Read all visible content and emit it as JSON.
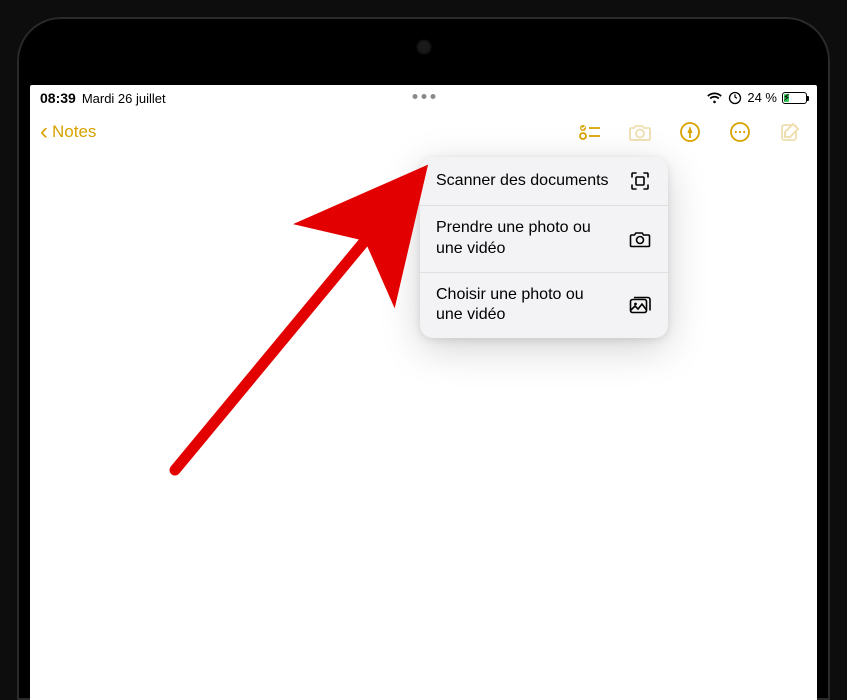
{
  "status": {
    "time": "08:39",
    "date": "Mardi 26 juillet",
    "battery_percent": "24 %",
    "battery_fill_pct": 24
  },
  "toolbar": {
    "back_label": "Notes"
  },
  "popover": {
    "items": [
      {
        "label": "Scanner des documents",
        "icon": "scan-icon"
      },
      {
        "label": "Prendre une photo ou une vidéo",
        "icon": "camera-icon"
      },
      {
        "label": "Choisir une photo ou une vidéo",
        "icon": "photo-library-icon"
      }
    ]
  },
  "icons": {
    "checklist": "checklist-icon",
    "camera": "camera-icon",
    "markup": "markup-icon",
    "more": "more-icon",
    "compose": "compose-icon"
  },
  "colors": {
    "accent": "#d8a200",
    "arrow": "#e30000",
    "battery_green": "#34c759"
  }
}
